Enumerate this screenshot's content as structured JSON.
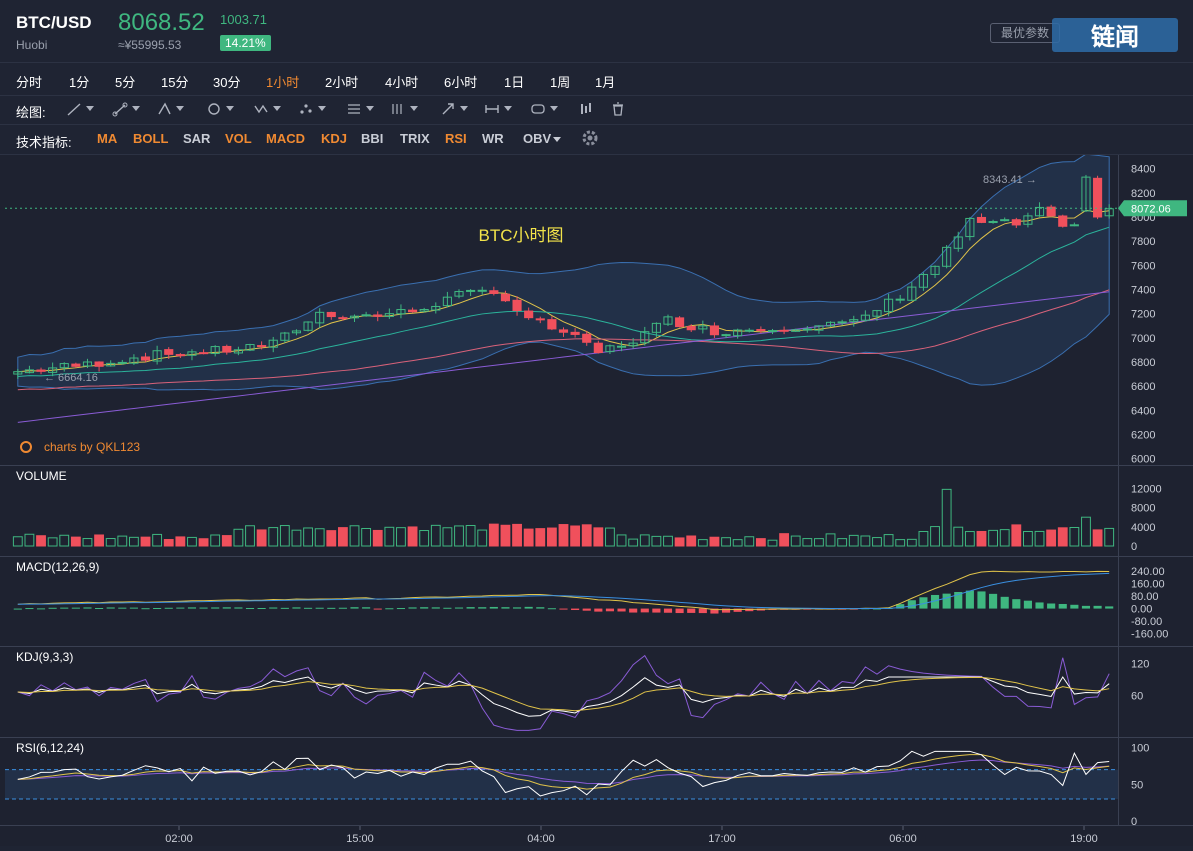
{
  "header": {
    "pair": "BTC/USD",
    "exchange": "Huobi",
    "price": "8068.52",
    "price_cny": "≈¥55995.53",
    "change": "1003.71",
    "change_pct": "14.21%",
    "params_button": "最优参数",
    "watermark": "链闻"
  },
  "intervals": [
    "分时",
    "1分",
    "5分",
    "15分",
    "30分",
    "1小时",
    "2小时",
    "4小时",
    "6小时",
    "1日",
    "1周",
    "1月"
  ],
  "active_interval": "1小时",
  "drawing": {
    "label": "绘图:"
  },
  "indicators": {
    "label": "技术指标:",
    "items": [
      {
        "label": "MA",
        "color": "#f08a32"
      },
      {
        "label": "BOLL",
        "color": "#f08a32"
      },
      {
        "label": "SAR",
        "color": "#c9cdd6"
      },
      {
        "label": "VOL",
        "color": "#f08a32"
      },
      {
        "label": "MACD",
        "color": "#f08a32"
      },
      {
        "label": "KDJ",
        "color": "#f08a32"
      },
      {
        "label": "BBI",
        "color": "#c9cdd6"
      },
      {
        "label": "TRIX",
        "color": "#c9cdd6"
      },
      {
        "label": "RSI",
        "color": "#f08a32"
      },
      {
        "label": "WR",
        "color": "#c9cdd6"
      },
      {
        "label": "OBV",
        "color": "#c9cdd6"
      }
    ]
  },
  "chart_data": {
    "type": "candlestick",
    "title": "BTC小时图",
    "credit": "charts by QKL123",
    "main": {
      "yticks": [
        "8400",
        "8200",
        "8000",
        "7800",
        "7600",
        "7400",
        "7200",
        "7000",
        "6800",
        "6600",
        "6400",
        "6200",
        "6000"
      ],
      "yrange": [
        5980,
        8480
      ],
      "current_price_tag": "8072.06",
      "current_price": 8072.06,
      "high_label": "8343.41",
      "low_label": "6664.16"
    },
    "xticks": [
      "02:00",
      "15:00",
      "04:00",
      "17:00",
      "06:00",
      "19:00"
    ],
    "volume": {
      "label": "VOLUME",
      "yticks": [
        "12000",
        "8000",
        "4000",
        "0"
      ],
      "ymax": 12500
    },
    "macd": {
      "label": "MACD(12,26,9)",
      "yticks": [
        "240.00",
        "160.00",
        "80.00",
        "0.00",
        "-80.00",
        "-160.00"
      ],
      "yrange": [
        -200,
        290
      ]
    },
    "kdj": {
      "label": "KDJ(9,3,3)",
      "yticks": [
        "120",
        "60"
      ],
      "yrange": [
        -10,
        140
      ]
    },
    "rsi": {
      "label": "RSI(6,12,24)",
      "yticks": [
        "100",
        "50",
        "0"
      ],
      "yrange": [
        0,
        105
      ]
    },
    "colors": {
      "up": "#3fb780",
      "down": "#f0505c",
      "ma_yellow": "#e0c34a",
      "ma_green": "#2bb39b",
      "ma_pink": "#d9627a",
      "ma_purple": "#8a5cd6",
      "boll": "#3a6fb0"
    }
  }
}
